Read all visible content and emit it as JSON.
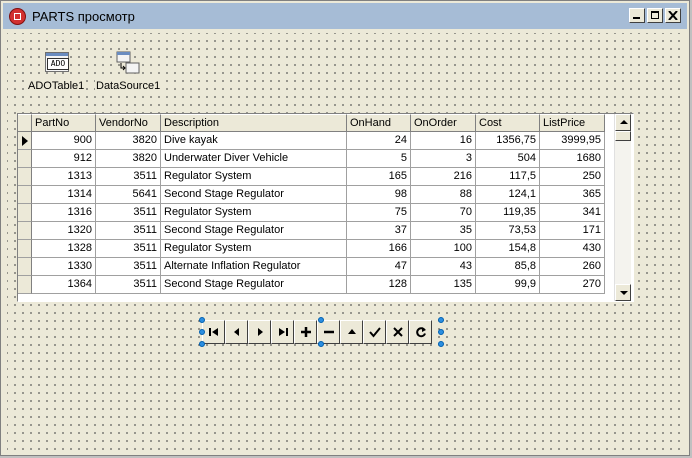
{
  "window": {
    "title": "PARTS просмотр"
  },
  "components": {
    "ado_label": "ADOTable1",
    "ado_glyph_text": "ADO",
    "ds_label": "DataSource1"
  },
  "grid": {
    "columns": [
      "PartNo",
      "VendorNo",
      "Description",
      "OnHand",
      "OnOrder",
      "Cost",
      "ListPrice"
    ],
    "rows": [
      [
        "900",
        "3820",
        "Dive kayak",
        "24",
        "16",
        "1356,75",
        "3999,95"
      ],
      [
        "912",
        "3820",
        "Underwater Diver Vehicle",
        "5",
        "3",
        "504",
        "1680"
      ],
      [
        "1313",
        "3511",
        "Regulator System",
        "165",
        "216",
        "117,5",
        "250"
      ],
      [
        "1314",
        "5641",
        "Second Stage Regulator",
        "98",
        "88",
        "124,1",
        "365"
      ],
      [
        "1316",
        "3511",
        "Regulator System",
        "75",
        "70",
        "119,35",
        "341"
      ],
      [
        "1320",
        "3511",
        "Second Stage Regulator",
        "37",
        "35",
        "73,53",
        "171"
      ],
      [
        "1328",
        "3511",
        "Regulator System",
        "166",
        "100",
        "154,8",
        "430"
      ],
      [
        "1330",
        "3511",
        "Alternate Inflation Regulator",
        "47",
        "43",
        "85,8",
        "260"
      ],
      [
        "1364",
        "3511",
        "Second Stage Regulator",
        "128",
        "135",
        "99,9",
        "270"
      ]
    ]
  },
  "navigator": {
    "buttons": [
      "first-icon",
      "prior-icon",
      "next-icon",
      "last-icon",
      "insert-icon",
      "delete-icon",
      "edit-icon",
      "post-icon",
      "cancel-icon",
      "refresh-icon"
    ]
  }
}
